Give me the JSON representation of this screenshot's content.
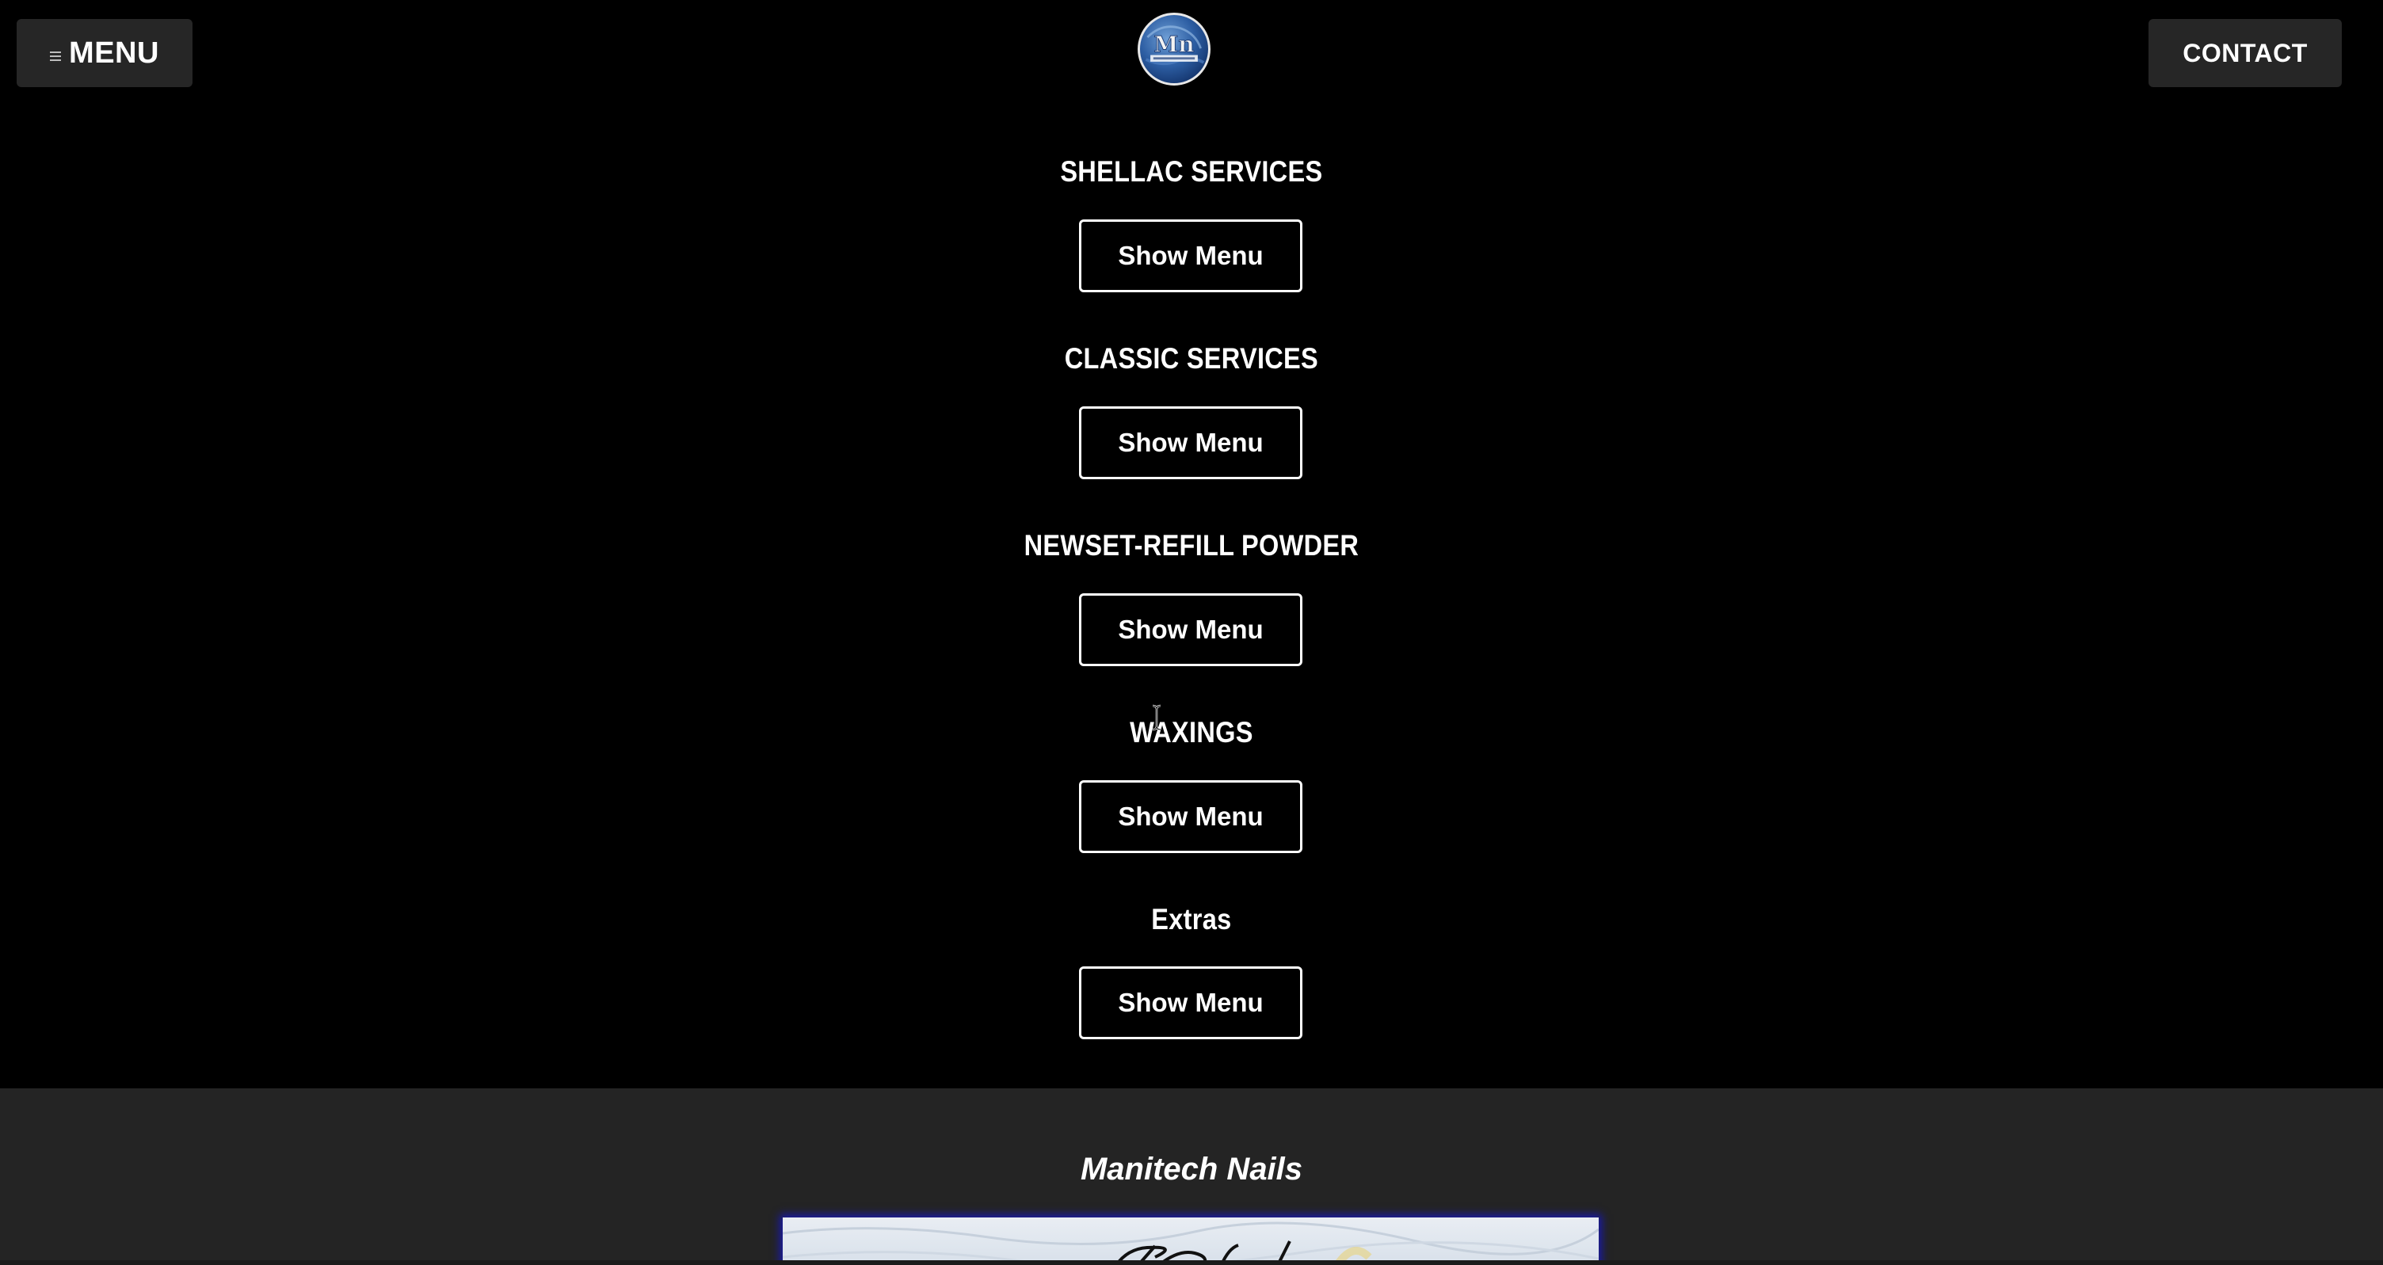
{
  "header": {
    "menu_label": "MENU",
    "contact_label": "CONTACT",
    "logo_text": "Mn"
  },
  "services": [
    {
      "title": "SHELLAC SERVICES",
      "button": "Show Menu"
    },
    {
      "title": "CLASSIC SERVICES",
      "button": "Show Menu"
    },
    {
      "title": "NEWSET-REFILL POWDER",
      "button": "Show Menu"
    },
    {
      "title": "WAXINGS",
      "button": "Show Menu"
    },
    {
      "title": "Extras",
      "button": "Show Menu"
    }
  ],
  "footer": {
    "title": "Manitech Nails"
  },
  "colors": {
    "background": "#000000",
    "header_button_bg": "#262626",
    "footer_bg": "#242424",
    "text": "#ffffff",
    "image_glow": "#1a1aa8"
  },
  "icons": {
    "menu": "hamburger-icon",
    "logo": "manitech-logo",
    "cursor": "text-cursor-icon"
  }
}
